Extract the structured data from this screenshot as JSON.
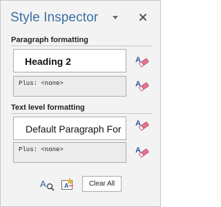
{
  "pane": {
    "title": "Style Inspector"
  },
  "paragraph": {
    "section_label": "Paragraph formatting",
    "style_name": "Heading 2",
    "plus_text": "Plus: <none>"
  },
  "text_level": {
    "section_label": "Text level formatting",
    "style_name": "Default Paragraph For",
    "plus_text": "Plus: <none>"
  },
  "bottom": {
    "clear_all_label": "Clear All"
  },
  "icons": {
    "title_dropdown": "chevron-down-icon",
    "close": "close-icon",
    "clear_format": "eraser-icon",
    "reveal_formatting": "reveal-formatting-icon",
    "new_style": "new-style-icon"
  },
  "colors": {
    "title": "#3a6ea5",
    "pane_background": "#f3f3f3",
    "eraser_pink": "#e8738f"
  }
}
